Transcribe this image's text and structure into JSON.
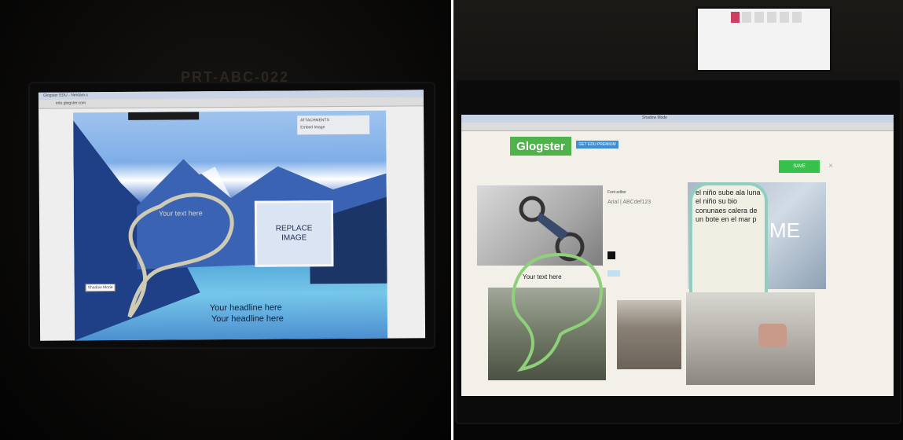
{
  "left_monitor": {
    "monitor_label": "PRT-ABC-022",
    "tab_title": "Glogster EDU - Nerdam.s",
    "address": "edu.glogster.com",
    "panel_title": "ATTACHMENTS",
    "panel_subtitle": "Embed Image",
    "replace_image_label": "REPLACE IMAGE",
    "bubble_text": "Your text here",
    "heading_line1": "Your headline here",
    "heading_line2": "Your headline here",
    "tooltip": "Shadow Mode"
  },
  "right_monitor": {
    "window_title": "Shadow Mode",
    "brand": "Glogster",
    "premium_button": "GET EDU PREMIUM",
    "save_button": "SAVE",
    "close_icon": "close-icon",
    "font_label": "Font editor",
    "font_value": "Arial | ABCdef123",
    "bubble_text": "Your text here",
    "scroll_text": "el niño sube ala luna el  niño su bio conunaes calera de un bote en el mar p",
    "partial_word": "ME"
  },
  "colors": {
    "glogster_green": "#4fb24a",
    "save_green": "#35c14a",
    "mountain_blue": "#3a6fd0",
    "paper": "#f2f0e8"
  }
}
